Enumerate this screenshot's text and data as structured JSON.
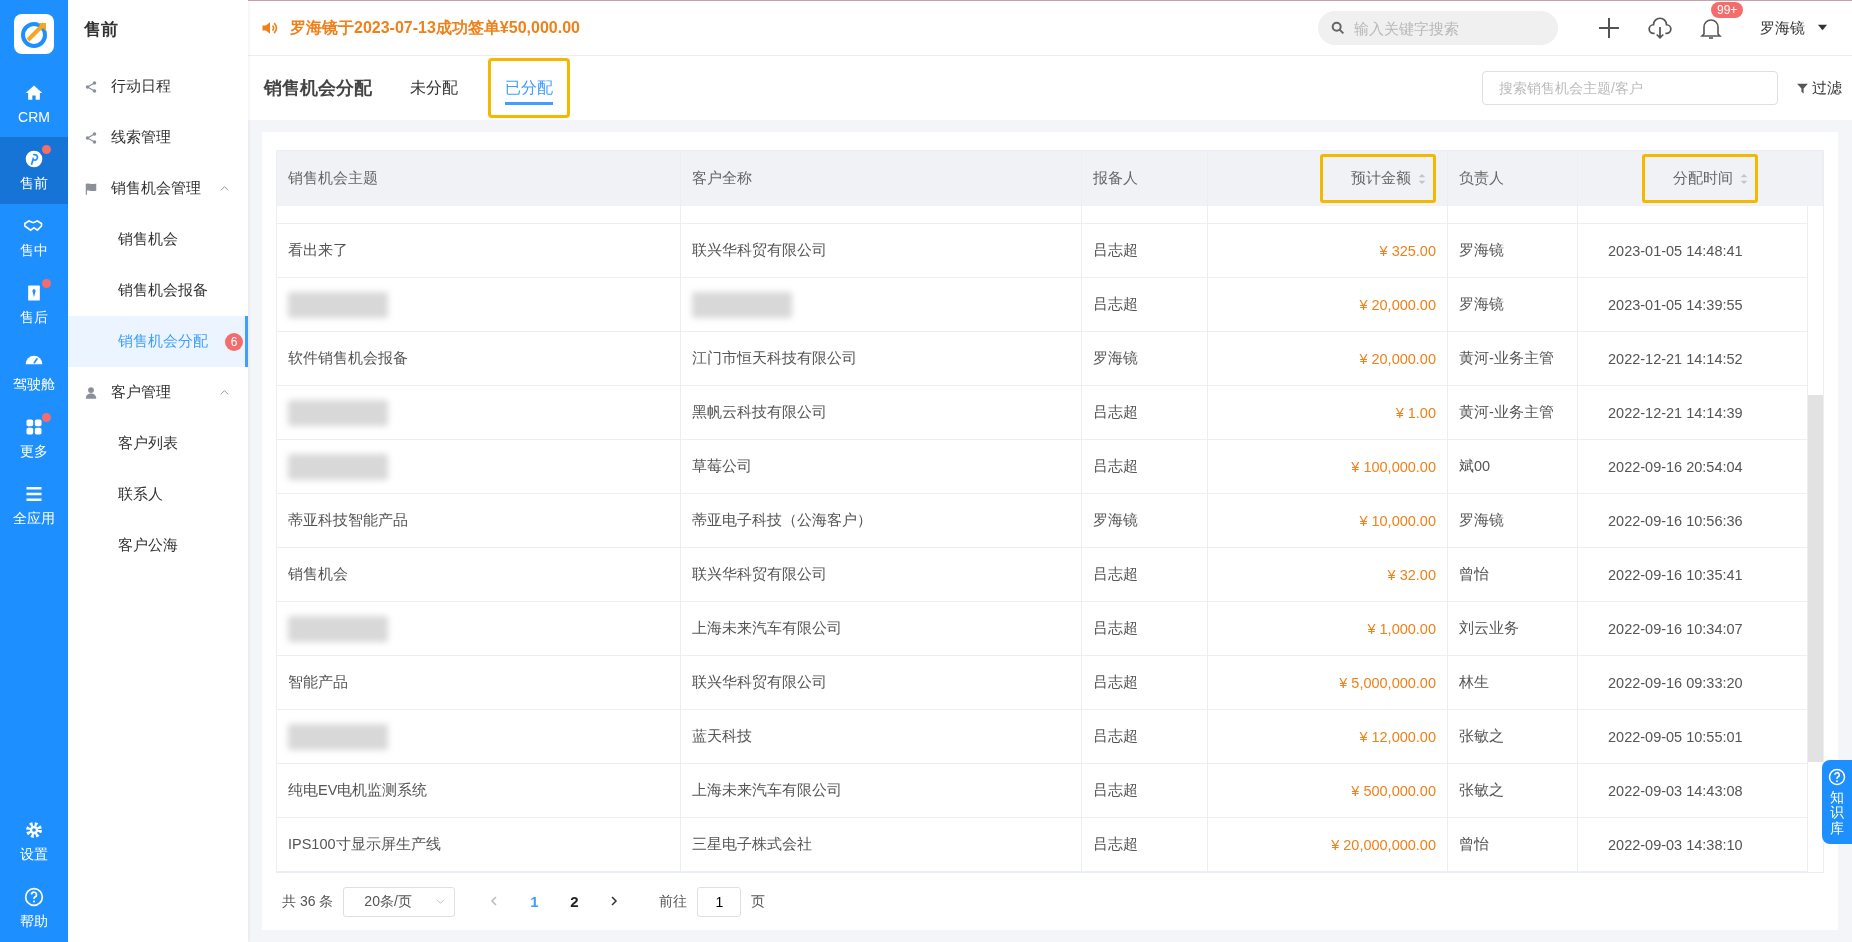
{
  "nav": [
    {
      "label": "CRM",
      "selected": false,
      "dot": false
    },
    {
      "label": "售前",
      "selected": true,
      "dot": true
    },
    {
      "label": "售中",
      "selected": false,
      "dot": false
    },
    {
      "label": "售后",
      "selected": false,
      "dot": true
    },
    {
      "label": "驾驶舱",
      "selected": false,
      "dot": false
    },
    {
      "label": "更多",
      "selected": false,
      "dot": true
    },
    {
      "label": "全应用",
      "selected": false,
      "dot": false
    }
  ],
  "nav_bottom": [
    {
      "label": "设置"
    },
    {
      "label": "帮助"
    }
  ],
  "sidebar": {
    "title": "售前",
    "items": [
      {
        "label": "行动日程"
      },
      {
        "label": "线索管理"
      },
      {
        "label": "销售机会管理",
        "expanded": true,
        "children": [
          {
            "label": "销售机会",
            "selected": false
          },
          {
            "label": "销售机会报备",
            "selected": false
          },
          {
            "label": "销售机会分配",
            "selected": true,
            "badge": "6"
          }
        ]
      },
      {
        "label": "客户管理",
        "expanded": true,
        "children": [
          {
            "label": "客户列表",
            "selected": false
          },
          {
            "label": "联系人",
            "selected": false
          },
          {
            "label": "客户公海",
            "selected": false
          }
        ]
      }
    ]
  },
  "topbar": {
    "notice": "罗海镜于2023-07-13成功签单¥50,000.00",
    "search_placeholder": "输入关键字搜索",
    "notification_badge": "99+",
    "user": "罗海镜"
  },
  "page": {
    "title": "销售机会分配",
    "tabs": [
      {
        "label": "未分配",
        "selected": false,
        "highlighted": false
      },
      {
        "label": "已分配",
        "selected": true,
        "highlighted": true
      }
    ],
    "search_placeholder": "搜索销售机会主题/客户",
    "filter": "过滤"
  },
  "table": {
    "columns": [
      {
        "label": "销售机会主题",
        "kind": "text",
        "sortable": false,
        "highlighted": false
      },
      {
        "label": "客户全称",
        "kind": "text",
        "sortable": false,
        "highlighted": false
      },
      {
        "label": "报备人",
        "kind": "text",
        "sortable": false,
        "highlighted": false
      },
      {
        "label": "预计金额",
        "kind": "amount",
        "sortable": true,
        "highlighted": true
      },
      {
        "label": "负责人",
        "kind": "text",
        "sortable": false,
        "highlighted": false
      },
      {
        "label": "分配时间",
        "kind": "time",
        "sortable": true,
        "highlighted": true
      }
    ],
    "rows": [
      [
        {
          "text": "看出来了"
        },
        {
          "text": "联兴华科贸有限公司"
        },
        {
          "text": "吕志超"
        },
        {
          "text": "¥ 325.00"
        },
        {
          "text": "罗海镜"
        },
        {
          "text": "2023-01-05 14:48:41"
        }
      ],
      [
        {
          "redacted": true
        },
        {
          "redacted": true
        },
        {
          "text": "吕志超"
        },
        {
          "text": "¥ 20,000.00"
        },
        {
          "text": "罗海镜"
        },
        {
          "text": "2023-01-05 14:39:55"
        }
      ],
      [
        {
          "text": "软件销售机会报备"
        },
        {
          "text": "江门市恒天科技有限公司"
        },
        {
          "text": "罗海镜"
        },
        {
          "text": "¥ 20,000.00"
        },
        {
          "text": "黄河-业务主管"
        },
        {
          "text": "2022-12-21 14:14:52"
        }
      ],
      [
        {
          "redacted": true
        },
        {
          "text": "黑帆云科技有限公司"
        },
        {
          "text": "吕志超"
        },
        {
          "text": "¥ 1.00"
        },
        {
          "text": "黄河-业务主管"
        },
        {
          "text": "2022-12-21 14:14:39"
        }
      ],
      [
        {
          "redacted": true
        },
        {
          "text": "草莓公司"
        },
        {
          "text": "吕志超"
        },
        {
          "text": "¥ 100,000.00"
        },
        {
          "text": "斌00"
        },
        {
          "text": "2022-09-16 20:54:04"
        }
      ],
      [
        {
          "text": "蒂亚科技智能产品"
        },
        {
          "text": "蒂亚电子科技（公海客户）"
        },
        {
          "text": "罗海镜"
        },
        {
          "text": "¥ 10,000.00"
        },
        {
          "text": "罗海镜"
        },
        {
          "text": "2022-09-16 10:56:36"
        }
      ],
      [
        {
          "text": "销售机会"
        },
        {
          "text": "联兴华科贸有限公司"
        },
        {
          "text": "吕志超"
        },
        {
          "text": "¥ 32.00"
        },
        {
          "text": "曾怡"
        },
        {
          "text": "2022-09-16 10:35:41"
        }
      ],
      [
        {
          "redacted": true
        },
        {
          "text": "上海未来汽车有限公司"
        },
        {
          "text": "吕志超"
        },
        {
          "text": "¥ 1,000.00"
        },
        {
          "text": "刘云业务"
        },
        {
          "text": "2022-09-16 10:34:07"
        }
      ],
      [
        {
          "text": "智能产品"
        },
        {
          "text": "联兴华科贸有限公司"
        },
        {
          "text": "吕志超"
        },
        {
          "text": "¥ 5,000,000.00"
        },
        {
          "text": "林生"
        },
        {
          "text": "2022-09-16 09:33:20"
        }
      ],
      [
        {
          "redacted": true
        },
        {
          "text": "蓝天科技"
        },
        {
          "text": "吕志超"
        },
        {
          "text": "¥ 12,000.00"
        },
        {
          "text": "张敏之"
        },
        {
          "text": "2022-09-05 10:55:01"
        }
      ],
      [
        {
          "text": "纯电EV电机监测系统"
        },
        {
          "text": "上海未来汽车有限公司"
        },
        {
          "text": "吕志超"
        },
        {
          "text": "¥ 500,000.00"
        },
        {
          "text": "张敏之"
        },
        {
          "text": "2022-09-03 14:43:08"
        }
      ],
      [
        {
          "text": "IPS100寸显示屏生产线"
        },
        {
          "text": "三星电子株式会社"
        },
        {
          "text": "吕志超"
        },
        {
          "text": "¥ 20,000,000.00"
        },
        {
          "text": "曾怡"
        },
        {
          "text": "2022-09-03 14:38:10"
        }
      ]
    ]
  },
  "pagination": {
    "total": "共 36 条",
    "page_size": "20条/页",
    "pages": [
      {
        "label": "1",
        "selected": true
      },
      {
        "label": "2",
        "selected": false
      }
    ],
    "goto_label": "前往",
    "goto_value": "1",
    "goto_suffix": "页"
  },
  "help_tab": "知识库"
}
